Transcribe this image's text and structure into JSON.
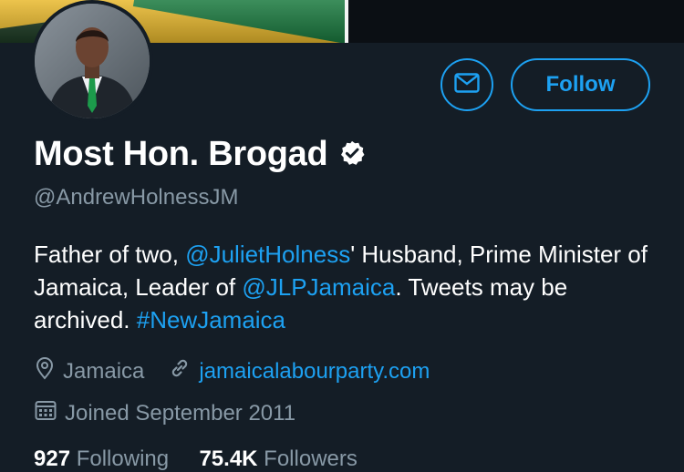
{
  "profile": {
    "display_name": "Most Hon. Brogad",
    "handle": "@AndrewHolnessJM",
    "verified": true
  },
  "buttons": {
    "message_icon": "envelope-icon",
    "follow_label": "Follow"
  },
  "bio": {
    "part1": "Father of two, ",
    "mention1": "@JulietHolness",
    "part2": "' Husband, Prime Minister of Jamaica, Leader of ",
    "mention2": "@JLPJamaica",
    "part3": ". Tweets may be archived. ",
    "hashtag": "#NewJamaica"
  },
  "meta": {
    "location": "Jamaica",
    "website": "jamaicalabourparty.com",
    "joined": "Joined September 2011"
  },
  "counts": {
    "following_value": "927",
    "following_label": "Following",
    "followers_value": "75.4K",
    "followers_label": "Followers"
  },
  "colors": {
    "background": "#141d26",
    "accent": "#1da1f2",
    "secondary_text": "#8899a6"
  }
}
